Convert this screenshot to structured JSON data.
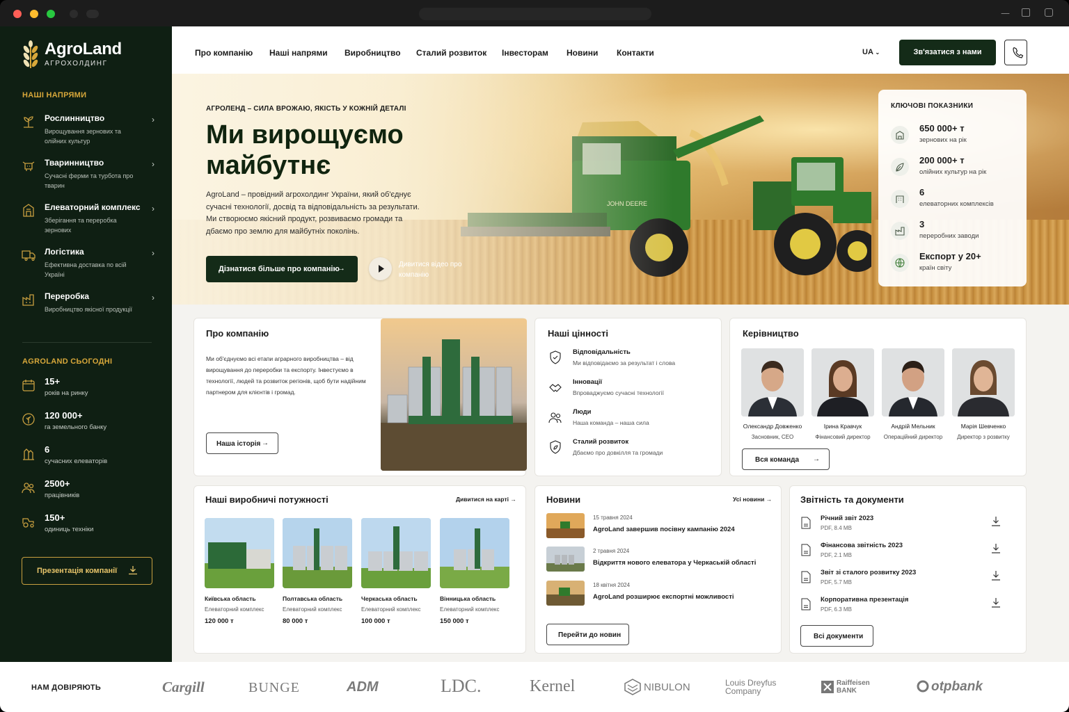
{
  "brand": {
    "name": "AgroLand",
    "subtitle": "АГРОХОЛДИНГ"
  },
  "sidebar": {
    "directions_heading": "НАШІ НАПРЯМИ",
    "directions": [
      {
        "title": "Рослинництво",
        "desc": "Вирощування зернових та олійних культур",
        "icon": "plant-icon"
      },
      {
        "title": "Тваринництво",
        "desc": "Сучасні ферми та турбота про тварин",
        "icon": "cow-icon"
      },
      {
        "title": "Елеваторний комплекс",
        "desc": "Зберігання та переробка зернових",
        "icon": "elevator-icon"
      },
      {
        "title": "Логістика",
        "desc": "Ефективна доставка по всій Україні",
        "icon": "truck-icon"
      },
      {
        "title": "Переробка",
        "desc": "Виробництво якісної продукції",
        "icon": "factory-icon"
      }
    ],
    "today_heading": "AGROLAND СЬОГОДНІ",
    "stats": [
      {
        "value": "15+",
        "label": "років на ринку",
        "icon": "calendar-icon"
      },
      {
        "value": "120 000+",
        "label": "га земельного банку",
        "icon": "land-icon"
      },
      {
        "value": "6",
        "label": "сучасних елеваторів",
        "icon": "silo-icon"
      },
      {
        "value": "2500+",
        "label": "працівників",
        "icon": "people-icon"
      },
      {
        "value": "150+",
        "label": "одиниць техніки",
        "icon": "tractor-icon"
      }
    ],
    "presentation_button": "Презентація компанії"
  },
  "header": {
    "nav": [
      "Про компанію",
      "Наші напрями",
      "Виробництво",
      "Сталий розвиток",
      "Інвесторам",
      "Новини",
      "Контакти"
    ],
    "lang": "UA",
    "cta": "Зв'язатися з нами"
  },
  "hero": {
    "eyebrow": "АГРОЛЕНД – СИЛА ВРОЖАЮ, ЯКІСТЬ У КОЖНІЙ ДЕТАЛІ",
    "title": "Ми вирощуємо майбутнє",
    "text": "AgroLand – провідний агрохолдинг України, який об'єднує сучасні технології, досвід та відповідальність за результати. Ми створюємо якісний продукт, розвиваємо громади та дбаємо про землю для майбутніх поколінь.",
    "button": "Дізнатися більше про компанію",
    "video": "Дивитися відео про компанію"
  },
  "kpi": {
    "heading": "КЛЮЧОВІ ПОКАЗНИКИ",
    "items": [
      {
        "value": "650 000+ т",
        "label": "зернових на рік",
        "icon": "grain-icon"
      },
      {
        "value": "200 000+ т",
        "label": "олійних культур на рік",
        "icon": "leaf-icon"
      },
      {
        "value": "6",
        "label": "елеваторних комплексів",
        "icon": "building-icon"
      },
      {
        "value": "3",
        "label": "переробних заводи",
        "icon": "factory-icon"
      },
      {
        "value": "Експорт у 20+",
        "label": "країн світу",
        "icon": "globe-icon"
      }
    ]
  },
  "about": {
    "title": "Про компанію",
    "text": "Ми об'єднуємо всі етапи аграрного виробництва – від вирощування до переробки та експорту. Інвестуємо в технології, людей та розвиток регіонів, щоб бути надійним партнером для клієнтів і громад.",
    "button": "Наша історія"
  },
  "values": {
    "title": "Наші цінності",
    "items": [
      {
        "title": "Відповідальність",
        "desc": "Ми відповідаємо за результат і слова",
        "icon": "shield-icon"
      },
      {
        "title": "Інновації",
        "desc": "Впроваджуємо сучасні технології",
        "icon": "handshake-icon"
      },
      {
        "title": "Люди",
        "desc": "Наша команда – наша сила",
        "icon": "people-icon"
      },
      {
        "title": "Сталий розвиток",
        "desc": "Дбаємо про довкілля та громади",
        "icon": "eco-shield-icon"
      }
    ]
  },
  "leadership": {
    "title": "Керівництво",
    "people": [
      {
        "name": "Олександр Довженко",
        "role": "Засновник, CEO"
      },
      {
        "name": "Ірина Кравчук",
        "role": "Фінансовий директор"
      },
      {
        "name": "Андрій Мельник",
        "role": "Операційний директор"
      },
      {
        "name": "Марія Шевченко",
        "role": "Директор з розвитку"
      }
    ],
    "button": "Вся команда"
  },
  "facilities": {
    "title": "Наші виробничі потужності",
    "map_link": "Дивитися на карті",
    "items": [
      {
        "region": "Київська область",
        "type": "Елеваторний комплекс",
        "capacity": "120 000 т"
      },
      {
        "region": "Полтавська область",
        "type": "Елеваторний комплекс",
        "capacity": "80 000 т"
      },
      {
        "region": "Черкаська область",
        "type": "Елеваторний комплекс",
        "capacity": "100 000 т"
      },
      {
        "region": "Вінницька область",
        "type": "Елеваторний комплекс",
        "capacity": "150 000 т"
      }
    ]
  },
  "news": {
    "title": "Новини",
    "all_link": "Усі новини",
    "items": [
      {
        "date": "15 травня 2024",
        "title": "AgroLand завершив посівну кампанію 2024"
      },
      {
        "date": "2 травня 2024",
        "title": "Відкриття нового елеватора у Черкаській області"
      },
      {
        "date": "18 квітня 2024",
        "title": "AgroLand розширює експортні можливості"
      }
    ],
    "button": "Перейти до новин"
  },
  "documents": {
    "title": "Звітність та документи",
    "items": [
      {
        "title": "Річний звіт 2023",
        "meta": "PDF, 8.4 MB"
      },
      {
        "title": "Фінансова звітність 2023",
        "meta": "PDF, 2.1 MB"
      },
      {
        "title": "Звіт зі сталого розвитку 2023",
        "meta": "PDF, 5.7 MB"
      },
      {
        "title": "Корпоративна презентація",
        "meta": "PDF, 6.3 MB"
      }
    ],
    "button": "Всі документи"
  },
  "trust": {
    "heading": "НАМ ДОВІРЯЮТЬ",
    "logos": [
      "Cargill",
      "BUNGE",
      "ADM",
      "LDC.",
      "Kernel",
      "NIBULON",
      "Louis Dreyfus Company",
      "Raiffeisen BANK",
      "otpbank"
    ]
  },
  "colors": {
    "dark_green": "#0f1f13",
    "button_green": "#142b18",
    "gold": "#d7a73a",
    "background": "#f4f3f0"
  }
}
